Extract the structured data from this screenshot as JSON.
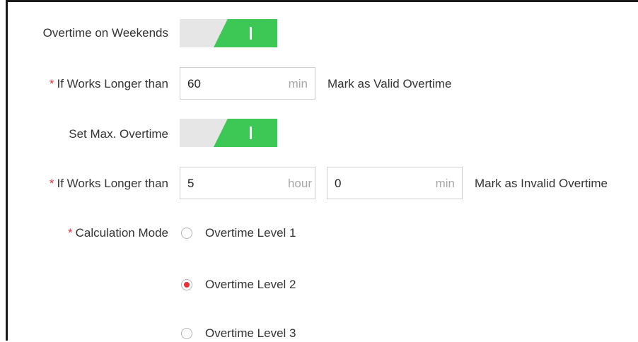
{
  "overtime_weekends": {
    "label": "Overtime on Weekends",
    "toggle_on": true
  },
  "valid_overtime": {
    "required_mark": "*",
    "label": "If Works Longer than",
    "value": "60",
    "unit": "min",
    "suffix": "Mark as Valid Overtime"
  },
  "max_overtime": {
    "label": "Set Max. Overtime",
    "toggle_on": true
  },
  "invalid_overtime": {
    "required_mark": "*",
    "label": "If Works Longer than",
    "hour_value": "5",
    "hour_unit": "hour",
    "min_value": "0",
    "min_unit": "min",
    "suffix": "Mark as Invalid Overtime"
  },
  "calculation_mode": {
    "required_mark": "*",
    "label": "Calculation Mode",
    "options": [
      {
        "label": "Overtime Level 1",
        "checked": false
      },
      {
        "label": "Overtime Level 2",
        "checked": true
      },
      {
        "label": "Overtime Level 3",
        "checked": false
      }
    ]
  },
  "colors": {
    "toggle_on": "#3dc856",
    "toggle_off": "#e6e6e6",
    "required": "#e8313a",
    "radio_selected": "#e8313a"
  }
}
